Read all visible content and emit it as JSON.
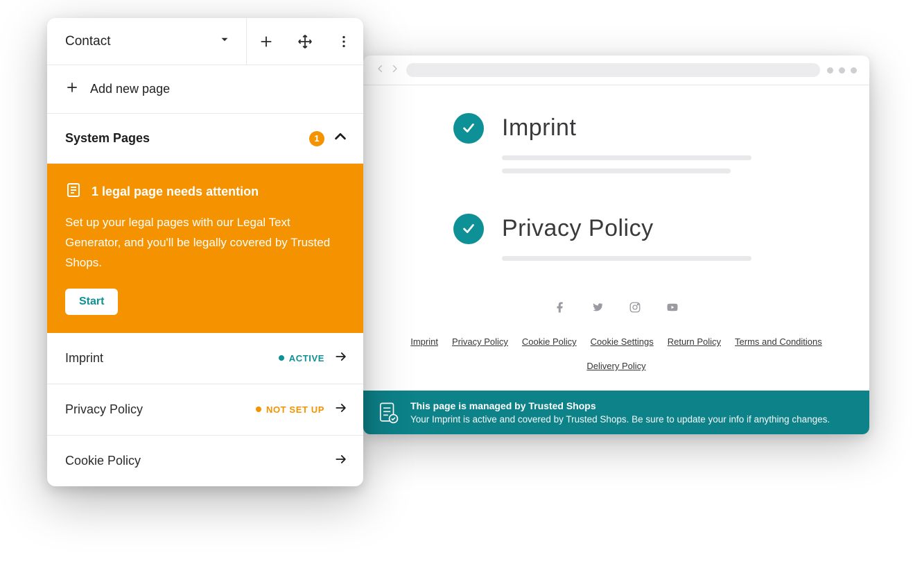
{
  "sidebar": {
    "page_selector": "Contact",
    "add_page_label": "Add new page",
    "section_title": "System Pages",
    "badge_count": "1",
    "alert": {
      "title": "1 legal page needs attention",
      "body": "Set up your legal pages with our Legal Text Generator, and you'll be legally covered by Trusted Shops.",
      "button": "Start"
    },
    "items": [
      {
        "label": "Imprint",
        "status_text": "ACTIVE",
        "status_kind": "active"
      },
      {
        "label": "Privacy Policy",
        "status_text": "NOT SET UP",
        "status_kind": "nsu"
      },
      {
        "label": "Cookie Policy",
        "status_text": "",
        "status_kind": ""
      }
    ]
  },
  "browser": {
    "docs": [
      {
        "title": "Imprint"
      },
      {
        "title": "Privacy Policy"
      }
    ],
    "footer_links": [
      "Imprint",
      "Privacy Policy",
      "Cookie Policy",
      "Cookie Settings",
      "Return Policy",
      "Terms and Conditions",
      "Delivery Policy"
    ],
    "banner": {
      "title": "This page is managed by Trusted Shops",
      "text": "Your Imprint is active and covered by Trusted Shops. Be sure to update your info if anything changes."
    }
  },
  "colors": {
    "teal": "#0d9196",
    "teal_dark": "#0d8289",
    "orange": "#f59200"
  }
}
